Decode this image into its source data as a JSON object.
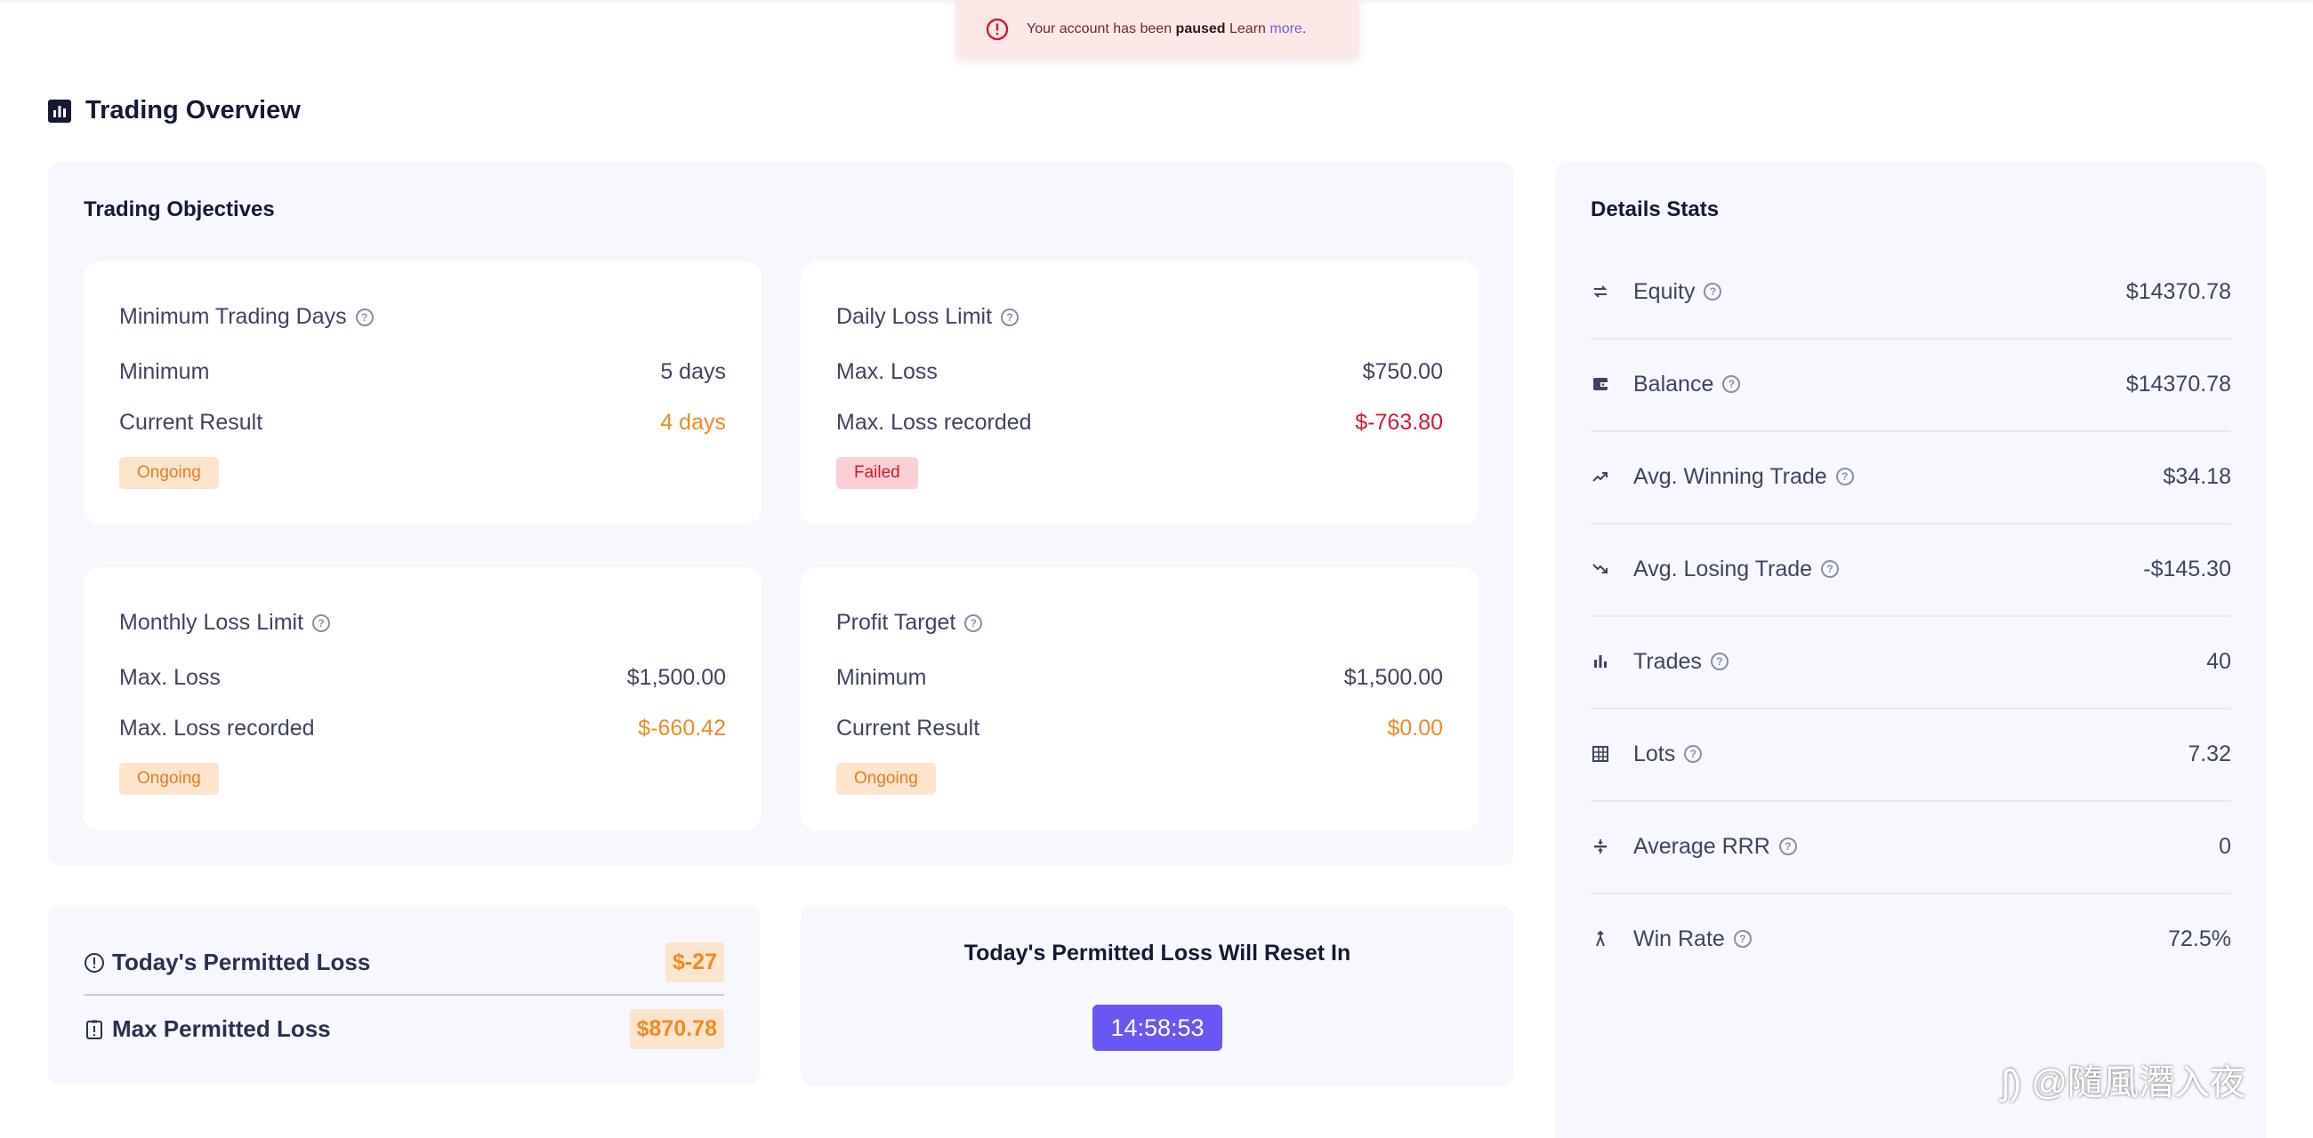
{
  "alert": {
    "prefix": "Your account has been ",
    "bold": "paused",
    "middle": " Learn ",
    "link": "more",
    "suffix": "."
  },
  "page": {
    "title": "Trading Overview"
  },
  "objectives": {
    "title": "Trading Objectives",
    "cards": [
      {
        "title": "Minimum Trading Days",
        "row1_label": "Minimum",
        "row1_value": "5 days",
        "row2_label": "Current Result",
        "row2_value": "4 days",
        "status": "Ongoing"
      },
      {
        "title": "Daily Loss Limit",
        "row1_label": "Max. Loss",
        "row1_value": "$750.00",
        "row2_label": "Max. Loss recorded",
        "row2_value": "$-763.80",
        "status": "Failed"
      },
      {
        "title": "Monthly Loss Limit",
        "row1_label": "Max. Loss",
        "row1_value": "$1,500.00",
        "row2_label": "Max. Loss recorded",
        "row2_value": "$-660.42",
        "status": "Ongoing"
      },
      {
        "title": "Profit Target",
        "row1_label": "Minimum",
        "row1_value": "$1,500.00",
        "row2_label": "Current Result",
        "row2_value": "$0.00",
        "status": "Ongoing"
      }
    ]
  },
  "stats": {
    "title": "Details Stats",
    "rows": [
      {
        "label": "Equity",
        "value": "$14370.78",
        "icon": "arrows-swap-icon"
      },
      {
        "label": "Balance",
        "value": "$14370.78",
        "icon": "wallet-icon"
      },
      {
        "label": "Avg. Winning Trade",
        "value": "$34.18",
        "icon": "trend-up-icon"
      },
      {
        "label": "Avg. Losing Trade",
        "value": "-$145.30",
        "icon": "trend-down-icon"
      },
      {
        "label": "Trades",
        "value": "40",
        "icon": "bar-chart-icon"
      },
      {
        "label": "Lots",
        "value": "7.32",
        "icon": "grid-icon"
      },
      {
        "label": "Average RRR",
        "value": "0",
        "icon": "divide-icon"
      },
      {
        "label": "Win Rate",
        "value": "72.5%",
        "icon": "win-rate-icon"
      }
    ]
  },
  "permitted": {
    "today_label": "Today's Permitted Loss",
    "today_value": "$-27",
    "max_label": "Max Permitted Loss",
    "max_value": "$870.78"
  },
  "reset": {
    "title": "Today's Permitted Loss Will Reset In",
    "timer": "14:58:53"
  },
  "colors": {
    "accent": "#6a57f2",
    "warning": "#f08a24",
    "danger": "#d6182e",
    "panel": "#f6f8fd"
  }
}
